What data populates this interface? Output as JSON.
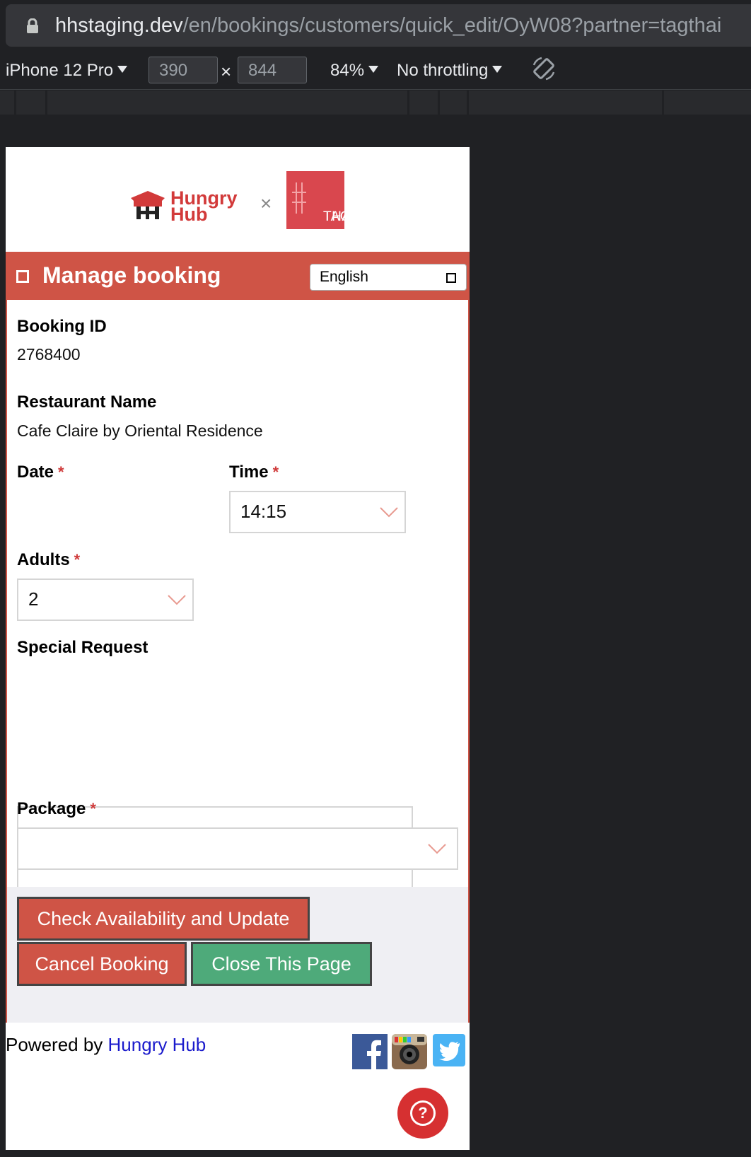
{
  "browser": {
    "url_host": "hhstaging.dev",
    "url_path": "/en/bookings/customers/quick_edit/OyW08?partner=tagthai"
  },
  "devtools": {
    "device": "iPhone 12 Pro",
    "width": "390",
    "height": "844",
    "times": "×",
    "zoom": "84%",
    "throttle": "No throttling"
  },
  "brand": {
    "hungry": "Hungry",
    "hub": "Hub",
    "times": "×",
    "partner_line1": "TAG",
    "partner_line2": "THAi",
    "partner_color": "#d9474e",
    "accent": "#cf5446"
  },
  "header": {
    "title": "Manage booking",
    "language": "English"
  },
  "form": {
    "booking_id_label": "Booking ID",
    "booking_id": "2768400",
    "restaurant_label": "Restaurant Name",
    "restaurant": "Cafe Claire by Oriental Residence",
    "date_label": "Date",
    "time_label": "Time",
    "time_value": "14:15",
    "adults_label": "Adults",
    "adults_value": "2",
    "special_label": "Special Request",
    "special_value": "",
    "package_label": "Package",
    "package_value": "",
    "required_mark": "*"
  },
  "actions": {
    "check": "Check Availability and Update",
    "cancel": "Cancel Booking",
    "close": "Close This Page"
  },
  "footer": {
    "powered": "Powered by ",
    "link": "Hungry Hub",
    "help": "?"
  },
  "icons": [
    "lock-icon",
    "rotate-icon",
    "hungry-hub-logo",
    "facebook-icon",
    "instagram-icon",
    "twitter-icon",
    "help-icon",
    "chevron-down-icon"
  ]
}
